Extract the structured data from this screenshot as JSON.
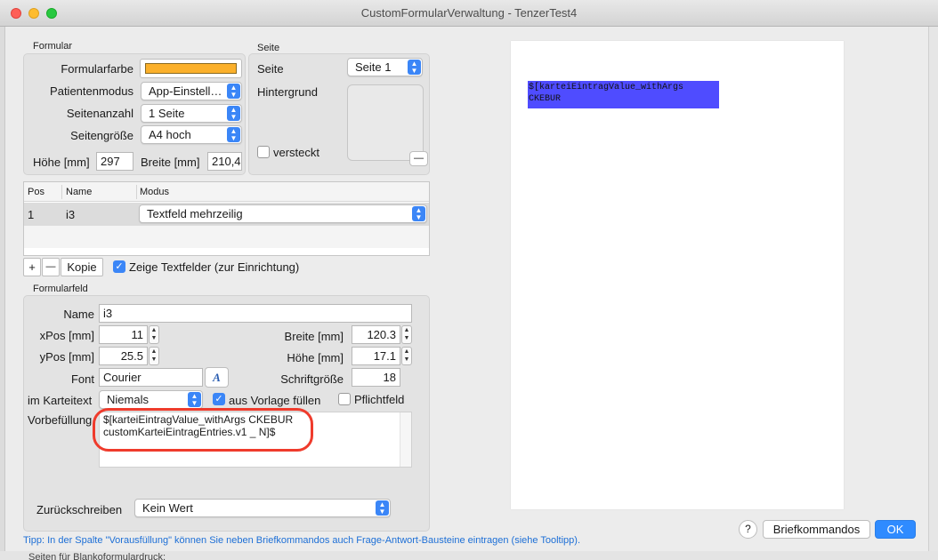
{
  "window": {
    "title": "CustomFormularVerwaltung - TenzerTest4"
  },
  "formular": {
    "section_label": "Formular",
    "farbe_label": "Formularfarbe",
    "farbe_color": "#fbb02b",
    "patientenmodus_label": "Patientenmodus",
    "patientenmodus_value": "App-Einstell…",
    "seitenanzahl_label": "Seitenanzahl",
    "seitenanzahl_value": "1 Seite",
    "seitengroesse_label": "Seitengröße",
    "seitengroesse_value": "A4 hoch",
    "hoehe_label": "Höhe [mm]",
    "hoehe_value": "297",
    "breite_label": "Breite [mm]",
    "breite_value": "210,4"
  },
  "seite": {
    "section_label": "Seite",
    "seite_label": "Seite",
    "seite_value": "Seite 1",
    "hintergrund_label": "Hintergrund",
    "versteckt_label": "versteckt",
    "remove_symbol": "—"
  },
  "fields_table": {
    "headers": [
      "Pos",
      "Name",
      "Modus"
    ],
    "rows": [
      {
        "pos": "1",
        "name": "i3",
        "modus": "Textfeld mehrzeilig"
      }
    ],
    "add_symbol": "+",
    "remove_symbol": "—",
    "kopie_label": "Kopie",
    "zeige_label": "Zeige Textfelder (zur Einrichtung)"
  },
  "formularfeld": {
    "section_label": "Formularfeld",
    "name_label": "Name",
    "name_value": "i3",
    "xpos_label": "xPos [mm]",
    "xpos_value": "11",
    "ypos_label": "yPos [mm]",
    "ypos_value": "25.5",
    "breite_label": "Breite [mm]",
    "breite_value": "120.3",
    "hoehe_label": "Höhe [mm]",
    "hoehe_value": "17.1",
    "font_label": "Font",
    "font_value": "Courier",
    "font_button": "A",
    "schriftgroesse_label": "Schriftgröße",
    "schriftgroesse_value": "18",
    "karteitext_label": "im Karteitext",
    "karteitext_value": "Niemals",
    "vorlage_label": "aus Vorlage füllen",
    "pflichtfeld_label": "Pflichtfeld",
    "vorbefuellung_label": "Vorbefüllung",
    "vorbefuellung_line1": "$[karteiEintragValue_withArgs CKEBUR",
    "vorbefuellung_line2": "customKarteiEintragEntries.v1 _ N]$",
    "zurueck_label": "Zurückschreiben",
    "zurueck_value": "Kein Wert"
  },
  "preview": {
    "line1": "$[karteiEintragValue_withArgs",
    "line2": "CKEBUR",
    "box_color": "#4f4cff"
  },
  "footer": {
    "tipp": "Tipp: In der Spalte \"Vorausfüllung\" können Sie neben Briefkommandos auch Frage-Antwort-Bausteine eintragen (siehe Tooltipp).",
    "help_label": "?",
    "briefkommandos_label": "Briefkommandos",
    "ok_label": "OK"
  },
  "background": {
    "bottom_text": "Seiten für Blankoformulardruck:"
  }
}
